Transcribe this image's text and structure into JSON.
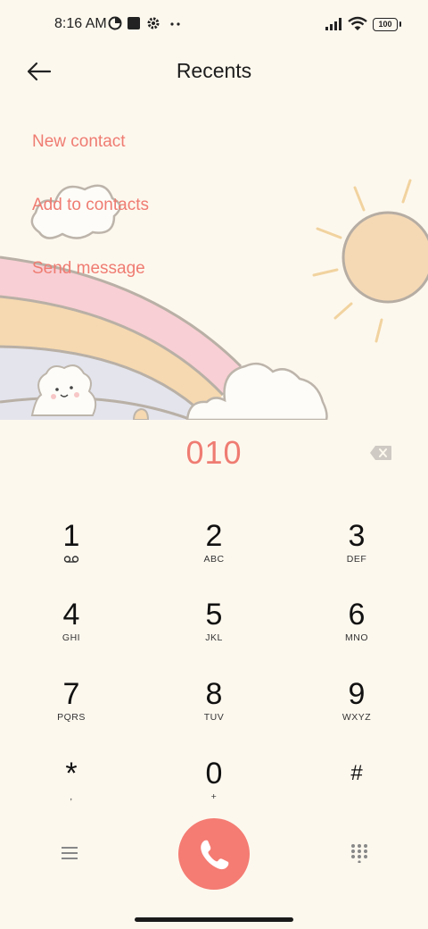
{
  "status_bar": {
    "time": "8:16 AM",
    "battery": "100",
    "icons": [
      "data-saver-icon",
      "square-notification-icon",
      "settings-icon",
      "more-dots-icon",
      "signal-icon",
      "wifi-icon",
      "battery-icon"
    ]
  },
  "header": {
    "title": "Recents",
    "back_icon": "back-arrow-icon"
  },
  "actions": {
    "new_contact": "New contact",
    "add_to_contacts": "Add to contacts",
    "send_message": "Send message"
  },
  "dialer": {
    "number": "010",
    "delete_icon": "backspace-icon"
  },
  "keypad": [
    {
      "digit": "1",
      "letters": ""
    },
    {
      "digit": "2",
      "letters": "ABC"
    },
    {
      "digit": "3",
      "letters": "DEF"
    },
    {
      "digit": "4",
      "letters": "GHI"
    },
    {
      "digit": "5",
      "letters": "JKL"
    },
    {
      "digit": "6",
      "letters": "MNO"
    },
    {
      "digit": "7",
      "letters": "PQRS"
    },
    {
      "digit": "8",
      "letters": "TUV"
    },
    {
      "digit": "9",
      "letters": "WXYZ"
    },
    {
      "digit": "*",
      "letters": ","
    },
    {
      "digit": "0",
      "letters": "+"
    },
    {
      "digit": "#",
      "letters": ""
    }
  ],
  "bottom_bar": {
    "menu_icon": "menu-icon",
    "call_icon": "phone-icon",
    "dialpad_icon": "dialpad-icon"
  },
  "colors": {
    "background": "#fdf8ee",
    "accent": "#ef7c72",
    "call_button": "#f47c73"
  }
}
